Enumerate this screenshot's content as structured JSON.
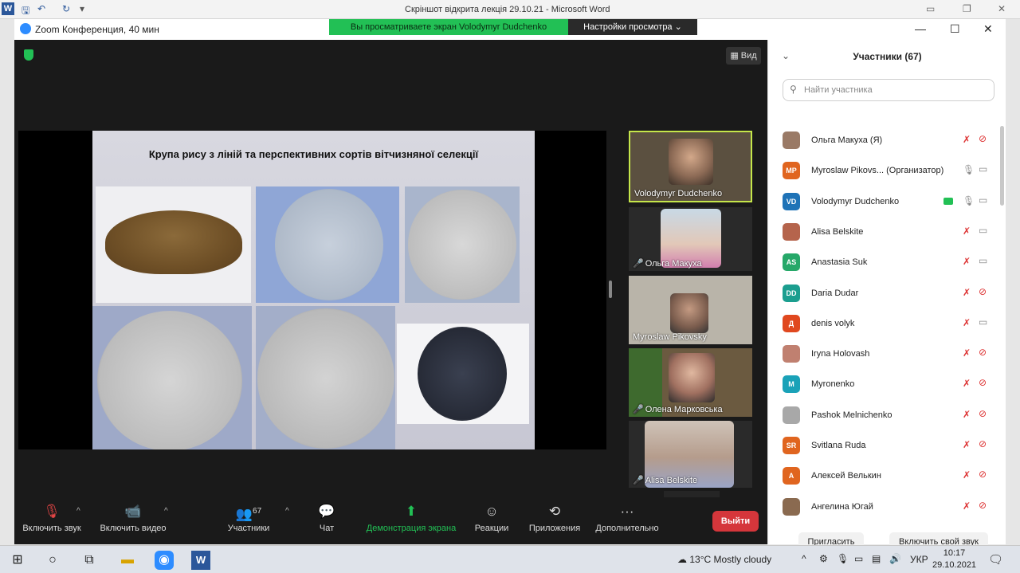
{
  "word": {
    "title": "Скріншот відкрита лекція 29.10.21 - Microsoft Word",
    "icon_letter": "W"
  },
  "zoom": {
    "window_title": "Zoom Конференция, 40 мин",
    "share_banner": "Вы просматриваете экран Volodymyr Dudchenko",
    "view_settings": "Настройки просмотра",
    "view_button": "Вид"
  },
  "slide": {
    "title": "Крупа рису з ліній та перспективних сортів вітчизняної селекції"
  },
  "gallery": [
    {
      "name": "Volodymyr Dudchenko",
      "muted": false,
      "active": true
    },
    {
      "name": "Ольга Макуха",
      "muted": true,
      "active": false
    },
    {
      "name": "Myroslaw Pikovsky",
      "muted": false,
      "active": false
    },
    {
      "name": "Олена Марковська",
      "muted": true,
      "active": false
    },
    {
      "name": "Alisa Belskite",
      "muted": true,
      "active": false
    }
  ],
  "toolbar": {
    "audio": "Включить звук",
    "video": "Включить видео",
    "participants": "Участники",
    "participants_count": "67",
    "chat": "Чат",
    "share": "Демонстрация экрана",
    "reactions": "Реакции",
    "apps": "Приложения",
    "more": "Дополнительно",
    "leave": "Выйти"
  },
  "panel": {
    "title": "Участники (67)",
    "search_placeholder": "Найти участника",
    "invite": "Пригласить",
    "unmute_me": "Включить свой звук",
    "participants": [
      {
        "initials": "",
        "name": "Ольга Макуха (Я)",
        "color": "#9a7a66",
        "mic": "muted",
        "cam": "off"
      },
      {
        "initials": "MP",
        "name": "Myroslaw Pikovs... (Организатор)",
        "color": "#e0651f",
        "mic": "on",
        "cam": "on"
      },
      {
        "initials": "VD",
        "name": "Volodymyr Dudchenko",
        "color": "#1f73b7",
        "mic": "on",
        "cam": "on",
        "sharing": true
      },
      {
        "initials": "",
        "name": "Alisa Belskite",
        "color": "#b5644c",
        "mic": "muted",
        "cam": "on"
      },
      {
        "initials": "AS",
        "name": "Anastasia Suk",
        "color": "#26a869",
        "mic": "muted",
        "cam": "on"
      },
      {
        "initials": "DD",
        "name": "Daria Dudar",
        "color": "#1b9e8f",
        "mic": "muted",
        "cam": "off"
      },
      {
        "initials": "Д",
        "name": "denis volyk",
        "color": "#e0481f",
        "mic": "muted",
        "cam": "on"
      },
      {
        "initials": "",
        "name": "Iryna Holovash",
        "color": "#c08070",
        "mic": "muted",
        "cam": "off"
      },
      {
        "initials": "M",
        "name": "Myronenko",
        "color": "#1aa2b8",
        "mic": "muted",
        "cam": "off"
      },
      {
        "initials": "",
        "name": "Pashok Melnichenko",
        "color": "#a8a8a8",
        "mic": "muted",
        "cam": "off"
      },
      {
        "initials": "SR",
        "name": "Svitlana Ruda",
        "color": "#e0651f",
        "mic": "muted",
        "cam": "off"
      },
      {
        "initials": "А",
        "name": "Алексей Велькин",
        "color": "#e0651f",
        "mic": "muted",
        "cam": "off"
      },
      {
        "initials": "",
        "name": "Ангелина Югай",
        "color": "#8a6a50",
        "mic": "muted",
        "cam": "off"
      }
    ]
  },
  "taskbar": {
    "weather": "13°C  Mostly cloudy",
    "language": "УКР",
    "time": "10:17",
    "date": "29.10.2021"
  }
}
